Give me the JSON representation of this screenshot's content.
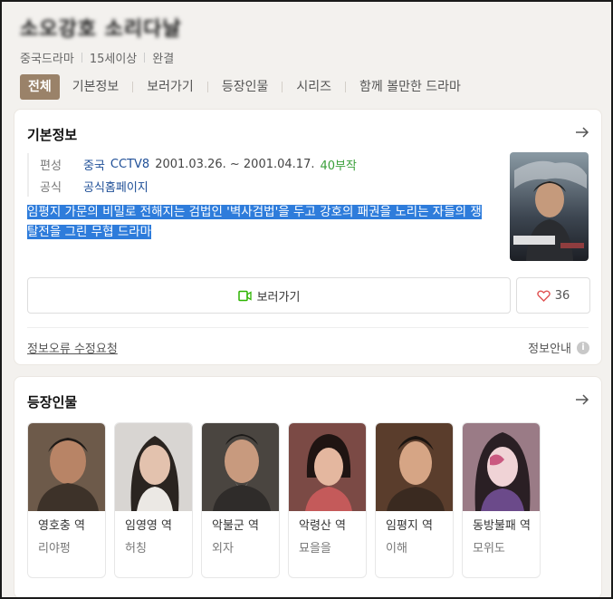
{
  "header": {
    "title": "소오강호 소리다날",
    "meta": [
      "중국드라마",
      "15세이상",
      "완결"
    ]
  },
  "tabs": [
    "전체",
    "기본정보",
    "보러가기",
    "등장인물",
    "시리즈",
    "함께 볼만한 드라마"
  ],
  "basic": {
    "title": "기본정보",
    "rows": {
      "broadcast_label": "편성",
      "country": "중국",
      "channel": "CCTV8",
      "dates": "2001.03.26. ~ 2001.04.17.",
      "episodes": "40부작",
      "official_label": "공식",
      "official_link": "공식홈페이지"
    },
    "synopsis_line1": "임평지 가문의 비밀로 전해지는 검법인 '벽사검법'을 두고 강호의 패권을 노리는 자들의 쟁",
    "synopsis_line2": "탈전을 그린 무협 드라마",
    "watch_label": "보러가기",
    "like_count": "36",
    "report_label": "정보오류 수정요청",
    "guide_label": "정보안내",
    "guide_icon": "i"
  },
  "cast": {
    "title": "등장인물",
    "items": [
      {
        "role": "영호충 역",
        "actor": "리야펑"
      },
      {
        "role": "임영영 역",
        "actor": "허칭"
      },
      {
        "role": "악불군 역",
        "actor": "외자"
      },
      {
        "role": "악령산 역",
        "actor": "묘을을"
      },
      {
        "role": "임평지 역",
        "actor": "이해"
      },
      {
        "role": "동방불패 역",
        "actor": "모위도"
      }
    ]
  },
  "colors": {
    "active_tab": "#9a8269",
    "link": "#1f4f97",
    "episodes_green": "#3aa03a",
    "highlight": "#2e7cdb"
  }
}
